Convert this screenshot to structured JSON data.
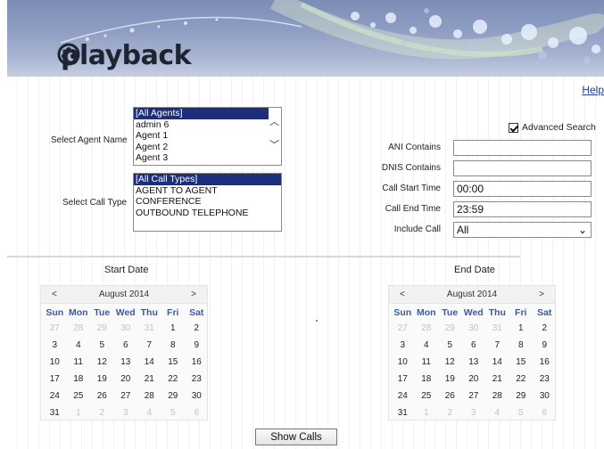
{
  "brand": {
    "logo_text": "playback"
  },
  "help": {
    "label": "Help"
  },
  "agent": {
    "label": "Select Agent Name",
    "options": [
      "[All Agents]",
      "admin 6",
      "Agent 1",
      "Agent 2",
      "Agent 3"
    ],
    "selected_index": 0
  },
  "calltype": {
    "label": "Select Call Type",
    "options": [
      "[All Call Types]",
      "AGENT TO AGENT",
      "CONFERENCE",
      "OUTBOUND TELEPHONE"
    ],
    "selected_index": 0
  },
  "advanced_search": {
    "label": "Advanced Search",
    "checked": true
  },
  "filters": {
    "ani_label": "ANI Contains",
    "ani_value": "",
    "dnis_label": "DNIS Contains",
    "dnis_value": "",
    "start_label": "Call Start Time",
    "start_value": "00:00",
    "end_label": "Call End Time",
    "end_value": "23:59",
    "include_label": "Include Call",
    "include_value": "All"
  },
  "start_calendar": {
    "title": "Start Date",
    "month": "August 2014",
    "prev": "<",
    "next": ">",
    "dow": [
      "Sun",
      "Mon",
      "Tue",
      "Wed",
      "Thu",
      "Fri",
      "Sat"
    ],
    "days": [
      "27",
      "28",
      "29",
      "30",
      "31",
      "1",
      "2",
      "3",
      "4",
      "5",
      "6",
      "7",
      "8",
      "9",
      "10",
      "11",
      "12",
      "13",
      "14",
      "15",
      "16",
      "17",
      "18",
      "19",
      "20",
      "21",
      "22",
      "23",
      "24",
      "25",
      "26",
      "27",
      "28",
      "29",
      "30",
      "31",
      "1",
      "2",
      "3",
      "4",
      "5",
      "6"
    ],
    "muted_indices": [
      0,
      1,
      2,
      3,
      4,
      36,
      37,
      38,
      39,
      40,
      41
    ]
  },
  "end_calendar": {
    "title": "End Date",
    "month": "August 2014",
    "prev": "<",
    "next": ">",
    "dow": [
      "Sun",
      "Mon",
      "Tue",
      "Wed",
      "Thu",
      "Fri",
      "Sat"
    ],
    "days": [
      "27",
      "28",
      "29",
      "30",
      "31",
      "1",
      "2",
      "3",
      "4",
      "5",
      "6",
      "7",
      "8",
      "9",
      "10",
      "11",
      "12",
      "13",
      "14",
      "15",
      "16",
      "17",
      "18",
      "19",
      "20",
      "21",
      "22",
      "23",
      "24",
      "25",
      "26",
      "27",
      "28",
      "29",
      "30",
      "31",
      "1",
      "2",
      "3",
      "4",
      "5",
      "6"
    ],
    "muted_indices": [
      0,
      1,
      2,
      3,
      4,
      36,
      37,
      38,
      39,
      40,
      41
    ]
  },
  "actions": {
    "show_calls": "Show Calls"
  }
}
